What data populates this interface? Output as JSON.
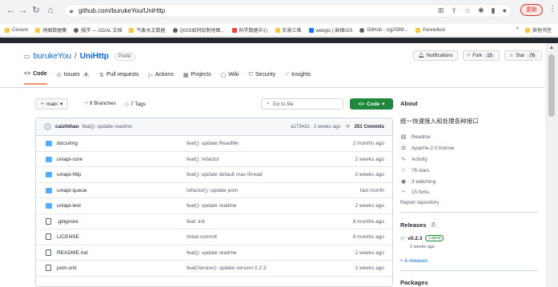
{
  "browser": {
    "url": "github.com/burukeYou/UniHttp",
    "update_label": "更新",
    "bookmarks": [
      {
        "label": "Cesium",
        "kind": "y"
      },
      {
        "label": "地图数据集",
        "kind": "y"
      },
      {
        "label": "报学 — GDAL 文档",
        "kind": "g"
      },
      {
        "label": "气象水文数据",
        "kind": "y"
      },
      {
        "label": "QGIS如何绘制地图...",
        "kind": "g"
      },
      {
        "label": "科学数据中心",
        "kind": "r"
      },
      {
        "label": "实景三维",
        "kind": "y"
      },
      {
        "label": "webgis | 麻辣GIS",
        "kind": "b"
      },
      {
        "label": "GitHub - zqj2599/...",
        "kind": "g"
      },
      {
        "label": "Pannellum",
        "kind": "y"
      }
    ],
    "bookmarks_more": "»",
    "bookmarks_other": "其他书签"
  },
  "repo": {
    "owner": "burukeYou",
    "slash": "/",
    "name": "UniHttp",
    "visibility": "Public",
    "notifications_label": "Notifications",
    "fork_label": "Fork",
    "fork_count": "15",
    "star_label": "Star",
    "star_count": "76"
  },
  "tabs": [
    {
      "label": "Code",
      "icon": "<>",
      "count": ""
    },
    {
      "label": "Issues",
      "icon": "⊙",
      "count": "4"
    },
    {
      "label": "Pull requests",
      "icon": "⇅",
      "count": ""
    },
    {
      "label": "Actions",
      "icon": "▷",
      "count": ""
    },
    {
      "label": "Projects",
      "icon": "▦",
      "count": ""
    },
    {
      "label": "Wiki",
      "icon": "▢",
      "count": ""
    },
    {
      "label": "Security",
      "icon": "⛉",
      "count": ""
    },
    {
      "label": "Insights",
      "icon": "⟋",
      "count": ""
    }
  ],
  "toolbar": {
    "branch": "main",
    "branches": "9 Branches",
    "tags": "7 Tags",
    "goto_placeholder": "Go to file",
    "code_label": "Code"
  },
  "commit": {
    "author": "caizhihao",
    "message": "feat(): update readme",
    "hash_time": "a17341b · 2 weeks ago",
    "commits": "251 Commits"
  },
  "files": [
    {
      "name": "docs/img",
      "type": "folder",
      "message": "feat(): update ReadMe",
      "time": "2 months ago"
    },
    {
      "name": "uniapi-core",
      "type": "folder",
      "message": "feat(): refactor",
      "time": "2 weeks ago"
    },
    {
      "name": "uniapi-http",
      "type": "folder",
      "message": "feat(): update default max thread",
      "time": "2 weeks ago"
    },
    {
      "name": "uniapi-queue",
      "type": "folder",
      "message": "refactor(): update pom",
      "time": "last month"
    },
    {
      "name": "uniapi-test",
      "type": "folder",
      "message": "feat(): update readme",
      "time": "2 weeks ago"
    },
    {
      "name": ".gitignore",
      "type": "file",
      "message": "feat: init",
      "time": "8 months ago"
    },
    {
      "name": "LICENSE",
      "type": "file",
      "message": "Initial commit",
      "time": "8 months ago"
    },
    {
      "name": "README.md",
      "type": "file",
      "message": "feat(): update readme",
      "time": "2 weeks ago"
    },
    {
      "name": "pom.xml",
      "type": "file",
      "message": "feat(Version): update version 0.2.3",
      "time": "2 weeks ago"
    }
  ],
  "about": {
    "title": "About",
    "description": "统一快速接入和处理各种接口",
    "items": [
      {
        "icon": "▤",
        "label": "Readme"
      },
      {
        "icon": "⚖",
        "label": "Apache-2.0 license"
      },
      {
        "icon": "∿",
        "label": "Activity"
      },
      {
        "icon": "☆",
        "label": "76 stars"
      },
      {
        "icon": "◉",
        "label": "3 watching"
      },
      {
        "icon": "⑂",
        "label": "15 forks"
      }
    ],
    "report": "Report repository"
  },
  "releases": {
    "title": "Releases",
    "count": "7",
    "tag": "v0.2.3",
    "latest": "Latest",
    "date": "2 weeks ago",
    "more": "+ 6 releases"
  },
  "packages": {
    "title": "Packages"
  }
}
